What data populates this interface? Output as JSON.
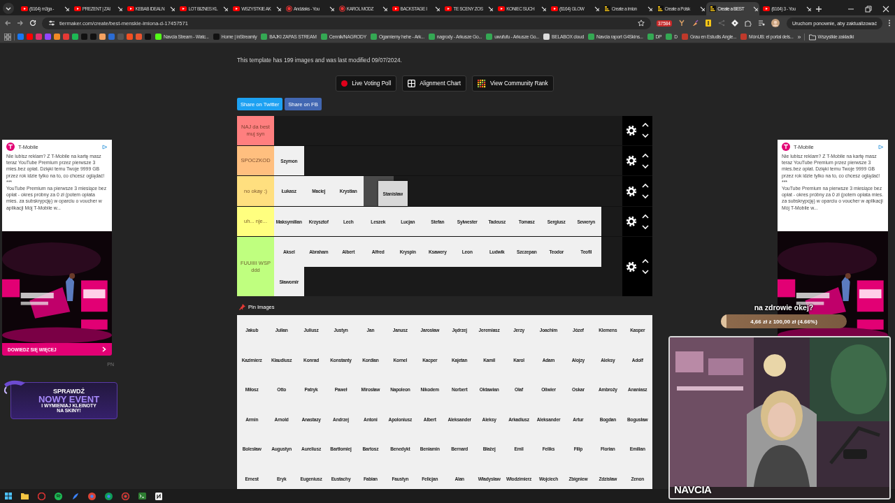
{
  "browser": {
    "tabs": [
      {
        "title": "(6164) m3ga -",
        "kind": "video",
        "selected": false
      },
      {
        "title": "PREZENT | ZAI",
        "kind": "video",
        "selected": false
      },
      {
        "title": "KEBAB IDEALN",
        "kind": "video",
        "selected": false
      },
      {
        "title": "LOT BIZNES KL",
        "kind": "video",
        "selected": false
      },
      {
        "title": "WSZYSTKIE AK",
        "kind": "video",
        "selected": false
      },
      {
        "title": "Andziaks - You",
        "kind": "channel",
        "selected": false
      },
      {
        "title": "KAROL MODZ",
        "kind": "channel",
        "selected": false
      },
      {
        "title": "BACKSTAGE I",
        "kind": "video",
        "selected": false
      },
      {
        "title": "TE SCENY ZOS",
        "kind": "video",
        "selected": false
      },
      {
        "title": "KONIEC SUCH",
        "kind": "video",
        "selected": false
      },
      {
        "title": "(6164) GLOW",
        "kind": "video",
        "selected": false
      },
      {
        "title": "Create a imion",
        "kind": "tiermaker",
        "selected": false
      },
      {
        "title": "Create a Polsk",
        "kind": "tiermaker",
        "selected": false
      },
      {
        "title": "Create a BEST",
        "kind": "tiermaker",
        "selected": true
      },
      {
        "title": "(6164) 3 - You",
        "kind": "video",
        "selected": false
      }
    ],
    "url": "tiermaker.com/create/best-menskie-imiona-d-17457571",
    "extension_badge": "37584",
    "update_button": "Uruchom ponownie, aby zaktualizować",
    "bookmarks": [
      {
        "color": "#1877f2"
      },
      {
        "color": "#ff0000"
      },
      {
        "color": "#e1306c"
      },
      {
        "color": "#9146ff"
      },
      {
        "color": "#f08a24"
      },
      {
        "color": "#e53935"
      },
      {
        "color": "#1db954"
      },
      {
        "color": "#111111"
      },
      {
        "color": "#111111"
      },
      {
        "color": "#f4a261"
      },
      {
        "color": "#2b6cd4"
      },
      {
        "color": "#555555"
      },
      {
        "color": "#f25022"
      },
      {
        "color": "#e8542f"
      },
      {
        "color": "#111111"
      },
      {
        "label": "Navcia Stream - Watc...",
        "color": "#53fc18"
      },
      {
        "label": "Home | inStreamly",
        "color": "#111111"
      },
      {
        "label": "BAJKI ZAPAS STREAM",
        "color": "#34a853"
      },
      {
        "label": "Cennik/NAGRODY",
        "color": "#34a853"
      },
      {
        "label": "Ogarniemy hehe - Ark...",
        "color": "#34a853"
      },
      {
        "label": "nagrody - Arkusze Go...",
        "color": "#34a853"
      },
      {
        "label": "uwufufu - Arkusze Go...",
        "color": "#34a853"
      },
      {
        "label": "BELABOX cloud",
        "color": "#dddddd"
      },
      {
        "label": "Navcia raport G4Skins...",
        "color": "#34a853"
      },
      {
        "label": "DP",
        "color": "#34a853"
      },
      {
        "label": "D",
        "color": "#34a853"
      },
      {
        "label": "Grau en Estudis Angle...",
        "color": "#c0392b"
      },
      {
        "label": "MónUB: el portal dels...",
        "color": "#c0392b"
      }
    ],
    "more_bookmarks": "»",
    "all_bookmarks": "Wszystkie zakładki"
  },
  "page": {
    "template_info": "This template has 199 images and was last modified 09/07/2024.",
    "actions": [
      {
        "label": "Live Voting Poll",
        "kind": "poll"
      },
      {
        "label": "Alignment Chart",
        "kind": "alignment"
      },
      {
        "label": "View Community Rank",
        "kind": "rank"
      }
    ],
    "share": [
      {
        "label": "Share on Twitter",
        "kind": "twitter"
      },
      {
        "label": "Share on FB",
        "kind": "facebook"
      }
    ],
    "tiers": [
      {
        "label": "NAJ da best muj syn",
        "color": "#ff7f7f"
      },
      {
        "label": "SPOCZKOD",
        "color": "#ffbf7f",
        "items": [
          "Szymon"
        ]
      },
      {
        "label": "no okay :)",
        "color": "#ffdf7f",
        "items": [
          {
            "name": "Łukasz",
            "kind": "tile"
          },
          {
            "name": "Maciej",
            "kind": "tile"
          },
          {
            "name": "Krystian",
            "kind": "tile"
          },
          {
            "kind": "placeholder"
          },
          {
            "name": "Stanisław",
            "kind": "dragged"
          }
        ]
      },
      {
        "label": "uh... nje...",
        "color": "#ffff7f",
        "items": [
          "Maksymilian",
          "Krzysztof",
          "Lech",
          "Leszek",
          "Lucjan",
          "Stefan",
          "Sylwester",
          "Tadeusz",
          "Tomasz",
          "Sergiusz",
          "Seweryn"
        ]
      },
      {
        "label": "FUUIIII WSP ddd",
        "color": "#bfff7f",
        "items": [
          "Aksel",
          "Abraham",
          "Albert",
          "Alfred",
          "Kryspin",
          "Ksawery",
          "Leon",
          "Ludwik",
          "Szczepan",
          "Teodor",
          "Teofil",
          "Sławomir"
        ]
      }
    ],
    "pin_images": "Pin Images",
    "pool": [
      "Jakub",
      "Julian",
      "Juliusz",
      "Justyn",
      "Jan",
      "Janusz",
      "Jarosław",
      "Jędrzej",
      "Jeremiasz",
      "Jerzy",
      "Joachim",
      "Józef",
      "Klemens",
      "Kasper",
      "Kazimierz",
      "Klaudiusz",
      "Konrad",
      "Konstanty",
      "Kordian",
      "Kornel",
      "Kacper",
      "Kajetan",
      "Kamil",
      "Karol",
      "Adam",
      "Alojzy",
      "Aleksy",
      "Adolf",
      "Miłosz",
      "Otto",
      "Patryk",
      "Paweł",
      "Mirosław",
      "Napoleon",
      "Nikodem",
      "Norbert",
      "Oktawian",
      "Olaf",
      "Oliwier",
      "Oskar",
      "Ambroży",
      "Ananiasz",
      "Armin",
      "Arnold",
      "Anastazy",
      "Andrzej",
      "Antoni",
      "Apoloniusz",
      "Albert",
      "Aleksander",
      "Aleksy",
      "Arkadiusz",
      "Aleksander",
      "Artur",
      "Bogdan",
      "Bogusław",
      "Bolesław",
      "Augustyn",
      "Aureliusz",
      "Bartłomiej",
      "Bartosz",
      "Benedykt",
      "Beniamin",
      "Bernard",
      "Błażej",
      "Emil",
      "Feliks",
      "Filip",
      "Florian",
      "Emilian",
      "Ernest",
      "Eryk",
      "Eugeniusz",
      "Eustachy",
      "Fabian",
      "Faustyn",
      "Felicjan",
      "Alan",
      "Władysław",
      "Włodzimierz",
      "Wojciech",
      "Zbigniew",
      "Zdzisław",
      "Zenon"
    ]
  },
  "ads": [
    {
      "brand": "T-Mobile",
      "paragraphs": [
        "Nie lubisz reklam? Z T-Mobile na kartę masz teraz YouTube Premium przez pierwsze 3 mies.bez opłat. Dzięki temu Twoje 9999 GB przez rok idzie tylko na to, co chcesz oglądać!",
        "***",
        "YouTube Premium na pierwsze 3 miesiące bez opłat - okres próbny za 0 zł (potem opłata mies. za subskrypcję) w oparciu o voucher w aplikacji Mój T-Mobile w..."
      ],
      "cta": "DOWIEDZ SIĘ WIĘCEJ",
      "mark": "PN"
    },
    {
      "brand": "T-Mobile",
      "paragraphs": [
        "Nie lubisz reklam? Z T-Mobile na kartę masz teraz YouTube Premium przez pierwsze 3 mies.bez opłat. Dzięki temu Twoje 9999 GB przez rok idzie tylko na to, co chcesz oglądać!",
        "***",
        "YouTube Premium na pierwsze 3 miesiące bez opłat - okres próbny za 0 zł (potem opłata mies. za subskrypcję) w oparciu o voucher w aplikacji Mój T-Mobile w..."
      ]
    }
  ],
  "overlay": {
    "event_banner": [
      "SPRAWDŹ",
      "NOWY EVENT",
      "I WYMIENIAJ KLEINOTY",
      "NA SKINY!"
    ],
    "goal": {
      "title": "na zdrowie okej?",
      "text": "4,66 zł z 100,00 zł (4.66%)",
      "level": 0.0466
    },
    "webcam_name": "NAVCIA"
  }
}
